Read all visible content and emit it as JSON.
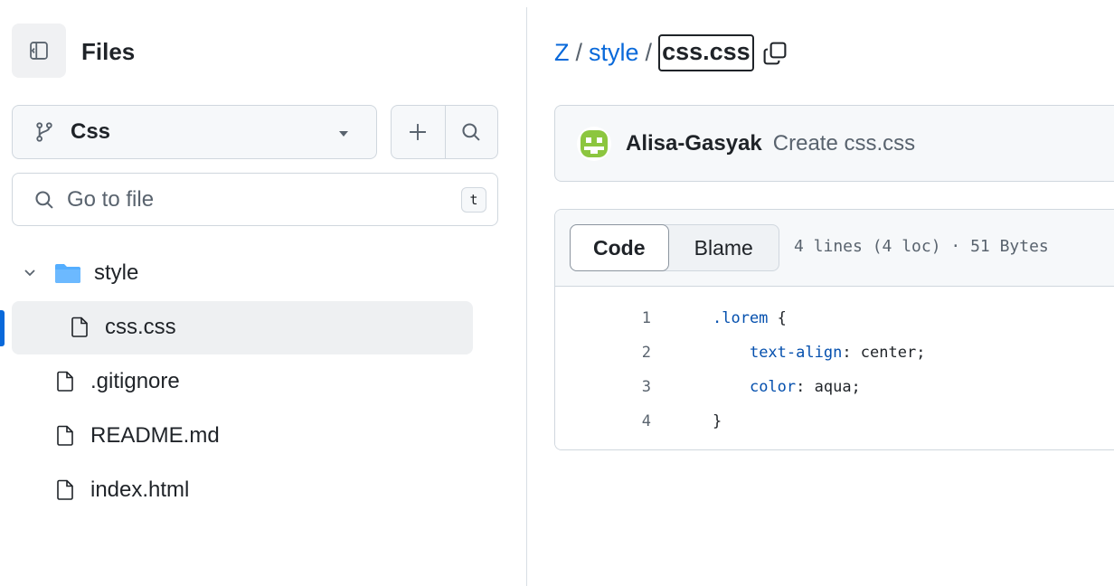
{
  "sidebar": {
    "title": "Files",
    "branch": "Css",
    "search": {
      "placeholder": "Go to file",
      "shortcut": "t"
    },
    "tree": [
      {
        "name": "style",
        "type": "folder",
        "expanded": true
      },
      {
        "name": "css.css",
        "type": "file",
        "active": true
      },
      {
        "name": ".gitignore",
        "type": "file"
      },
      {
        "name": "README.md",
        "type": "file"
      },
      {
        "name": "index.html",
        "type": "file"
      }
    ]
  },
  "breadcrumb": {
    "repo": "Z",
    "folder": "style",
    "separator": "/",
    "current": "css.css"
  },
  "commit": {
    "author": "Alisa-Gasyak",
    "message": "Create css.css"
  },
  "viewer": {
    "tabs": {
      "code": "Code",
      "blame": "Blame"
    },
    "meta": "4 lines (4 loc) · 51 Bytes",
    "lines": [
      {
        "num": "1",
        "selector": ".lorem",
        "rest": " {"
      },
      {
        "num": "2",
        "indent": "    ",
        "prop": "text-align",
        "rest": ": center;"
      },
      {
        "num": "3",
        "indent": "    ",
        "prop": "color",
        "rest": ": aqua;"
      },
      {
        "num": "4",
        "rest": "}"
      }
    ]
  },
  "colors": {
    "link": "#0969da",
    "accent_bar": "#0969da",
    "folder": "#54aeff",
    "avatar_green": "#8cc63f"
  },
  "icons": {
    "sidebar_toggle": "sidebar-collapse-icon",
    "branch": "git-branch-icon",
    "caret": "triangle-down-icon",
    "add": "plus-icon",
    "search": "search-icon",
    "folder": "folder-icon",
    "file": "file-icon",
    "chevron": "chevron-down-icon",
    "copy": "copy-icon"
  }
}
